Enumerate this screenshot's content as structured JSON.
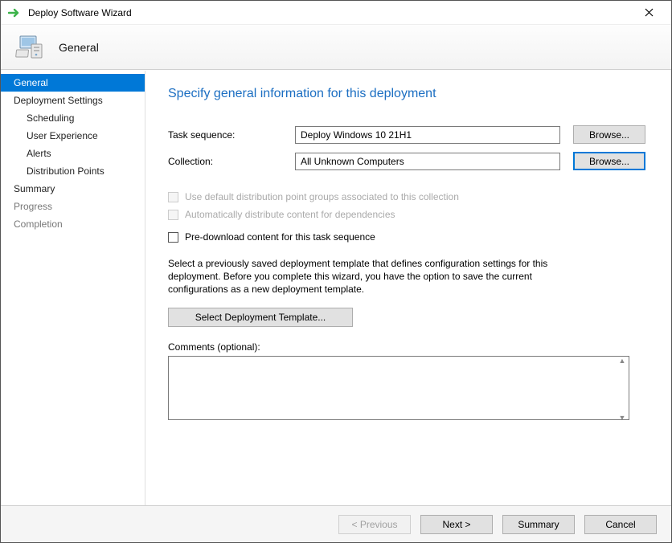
{
  "window": {
    "title": "Deploy Software Wizard"
  },
  "header": {
    "title": "General"
  },
  "sidebar": {
    "items": [
      {
        "label": "General",
        "selected": true,
        "indent": false,
        "dim": false
      },
      {
        "label": "Deployment Settings",
        "selected": false,
        "indent": false,
        "dim": false
      },
      {
        "label": "Scheduling",
        "selected": false,
        "indent": true,
        "dim": false
      },
      {
        "label": "User Experience",
        "selected": false,
        "indent": true,
        "dim": false
      },
      {
        "label": "Alerts",
        "selected": false,
        "indent": true,
        "dim": false
      },
      {
        "label": "Distribution Points",
        "selected": false,
        "indent": true,
        "dim": false
      },
      {
        "label": "Summary",
        "selected": false,
        "indent": false,
        "dim": false
      },
      {
        "label": "Progress",
        "selected": false,
        "indent": false,
        "dim": true
      },
      {
        "label": "Completion",
        "selected": false,
        "indent": false,
        "dim": true
      }
    ]
  },
  "content": {
    "heading": "Specify general information for this deployment",
    "task_label": "Task sequence:",
    "task_value": "Deploy Windows 10 21H1",
    "task_browse": "Browse...",
    "collection_label": "Collection:",
    "collection_value": "All Unknown Computers",
    "collection_browse": "Browse...",
    "cb1_label": "Use default distribution point groups associated to this collection",
    "cb2_label": "Automatically distribute content for dependencies",
    "cb3_label": "Pre-download content for this task sequence",
    "desc": "Select a previously saved deployment template that defines configuration settings for this deployment. Before you complete this wizard, you have the option to save the current configurations as a new deployment template.",
    "template_btn": "Select Deployment Template...",
    "comments_label": "Comments (optional):",
    "comments_value": ""
  },
  "footer": {
    "previous": "< Previous",
    "next": "Next >",
    "summary": "Summary",
    "cancel": "Cancel"
  }
}
